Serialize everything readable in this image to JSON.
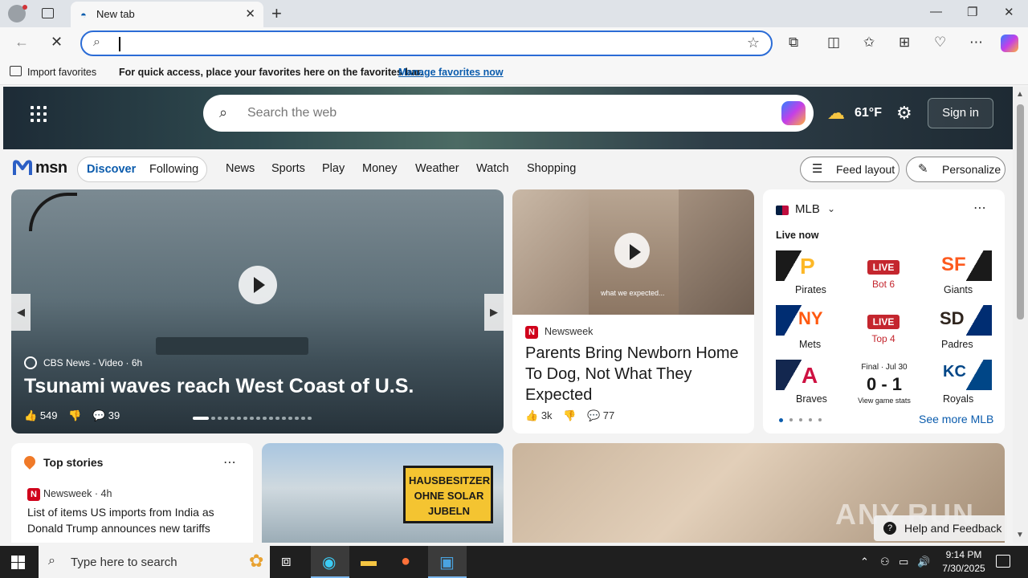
{
  "browser": {
    "tab_title": "New tab",
    "window_controls": {
      "minimize": "—",
      "restore": "❐",
      "close": "✕"
    },
    "favorites_bar": {
      "import_label": "Import favorites",
      "message": "For quick access, place your favorites here on the favorites bar.",
      "manage_link": "Manage favorites now"
    }
  },
  "msn": {
    "search_placeholder": "Search the web",
    "weather_temp": "61°F",
    "sign_in": "Sign in",
    "logo": "msn",
    "feed_tabs": [
      "Discover",
      "Following"
    ],
    "nav": [
      "News",
      "Sports",
      "Play",
      "Money",
      "Weather",
      "Watch",
      "Shopping"
    ],
    "feed_layout": "Feed layout",
    "personalize": "Personalize",
    "hero": {
      "source": "CBS News - Video · 6h",
      "headline": "Tsunami waves reach West Coast of U.S.",
      "likes": "549",
      "comments": "39"
    },
    "newsweek_card": {
      "source": "Newsweek",
      "headline": "Parents Bring Newborn Home To Dog, Not What They Expected",
      "image_caption": "what we expected...",
      "likes": "3k",
      "comments": "77"
    },
    "mlb": {
      "league": "MLB",
      "live_now": "Live now",
      "games": [
        {
          "away": "Pirates",
          "home": "Giants",
          "away_logo": "P",
          "home_logo": "SF",
          "badge": "LIVE",
          "status": "Bot 6"
        },
        {
          "away": "Mets",
          "home": "Padres",
          "away_logo": "NY",
          "home_logo": "SD",
          "badge": "LIVE",
          "status": "Top 4"
        },
        {
          "away": "Braves",
          "home": "Royals",
          "away_logo": "A",
          "home_logo": "KC",
          "final": "Final · Jul 30",
          "score": "0 - 1",
          "stats": "View game stats"
        }
      ],
      "see_more": "See more MLB"
    },
    "top_stories": {
      "title": "Top stories",
      "source": "Newsweek · 4h",
      "headline": "List of items US imports from India as Donald Trump announces new tariffs"
    },
    "solar_sign": [
      "HAUSBESITZER",
      "OHNE SOLAR",
      "JUBELN"
    ],
    "help": "Help and Feedback",
    "watermark": "ANY.RUN"
  },
  "taskbar": {
    "search_placeholder": "Type here to search",
    "time": "9:14 PM",
    "date": "7/30/2025"
  }
}
